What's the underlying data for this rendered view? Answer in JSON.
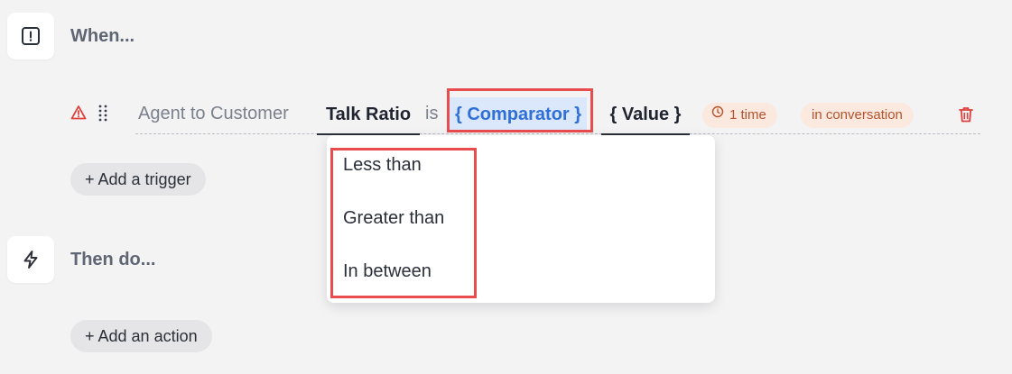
{
  "when_section": {
    "title": "When...",
    "icon": "alert-square-icon"
  },
  "trigger": {
    "subject": "Agent to Customer",
    "metric": "Talk Ratio",
    "connector": "is",
    "comparator_placeholder": "{ Comparator }",
    "value_placeholder": "{ Value }",
    "frequency": "1 time",
    "scope": "in conversation",
    "warning_icon": "warning-triangle-icon",
    "delete_icon": "trash-icon"
  },
  "comparator_dropdown": {
    "options": [
      "Less than",
      "Greater than",
      "In between"
    ]
  },
  "add_trigger_label": "+ Add a trigger",
  "then_section": {
    "title": "Then do...",
    "icon": "lightning-icon"
  },
  "add_action_label": "+ Add an action",
  "colors": {
    "accent_blue": "#2f6fd8",
    "highlight_red": "#e84c4f",
    "pill_text": "#b4532d",
    "pill_bg": "#fbe9df"
  }
}
